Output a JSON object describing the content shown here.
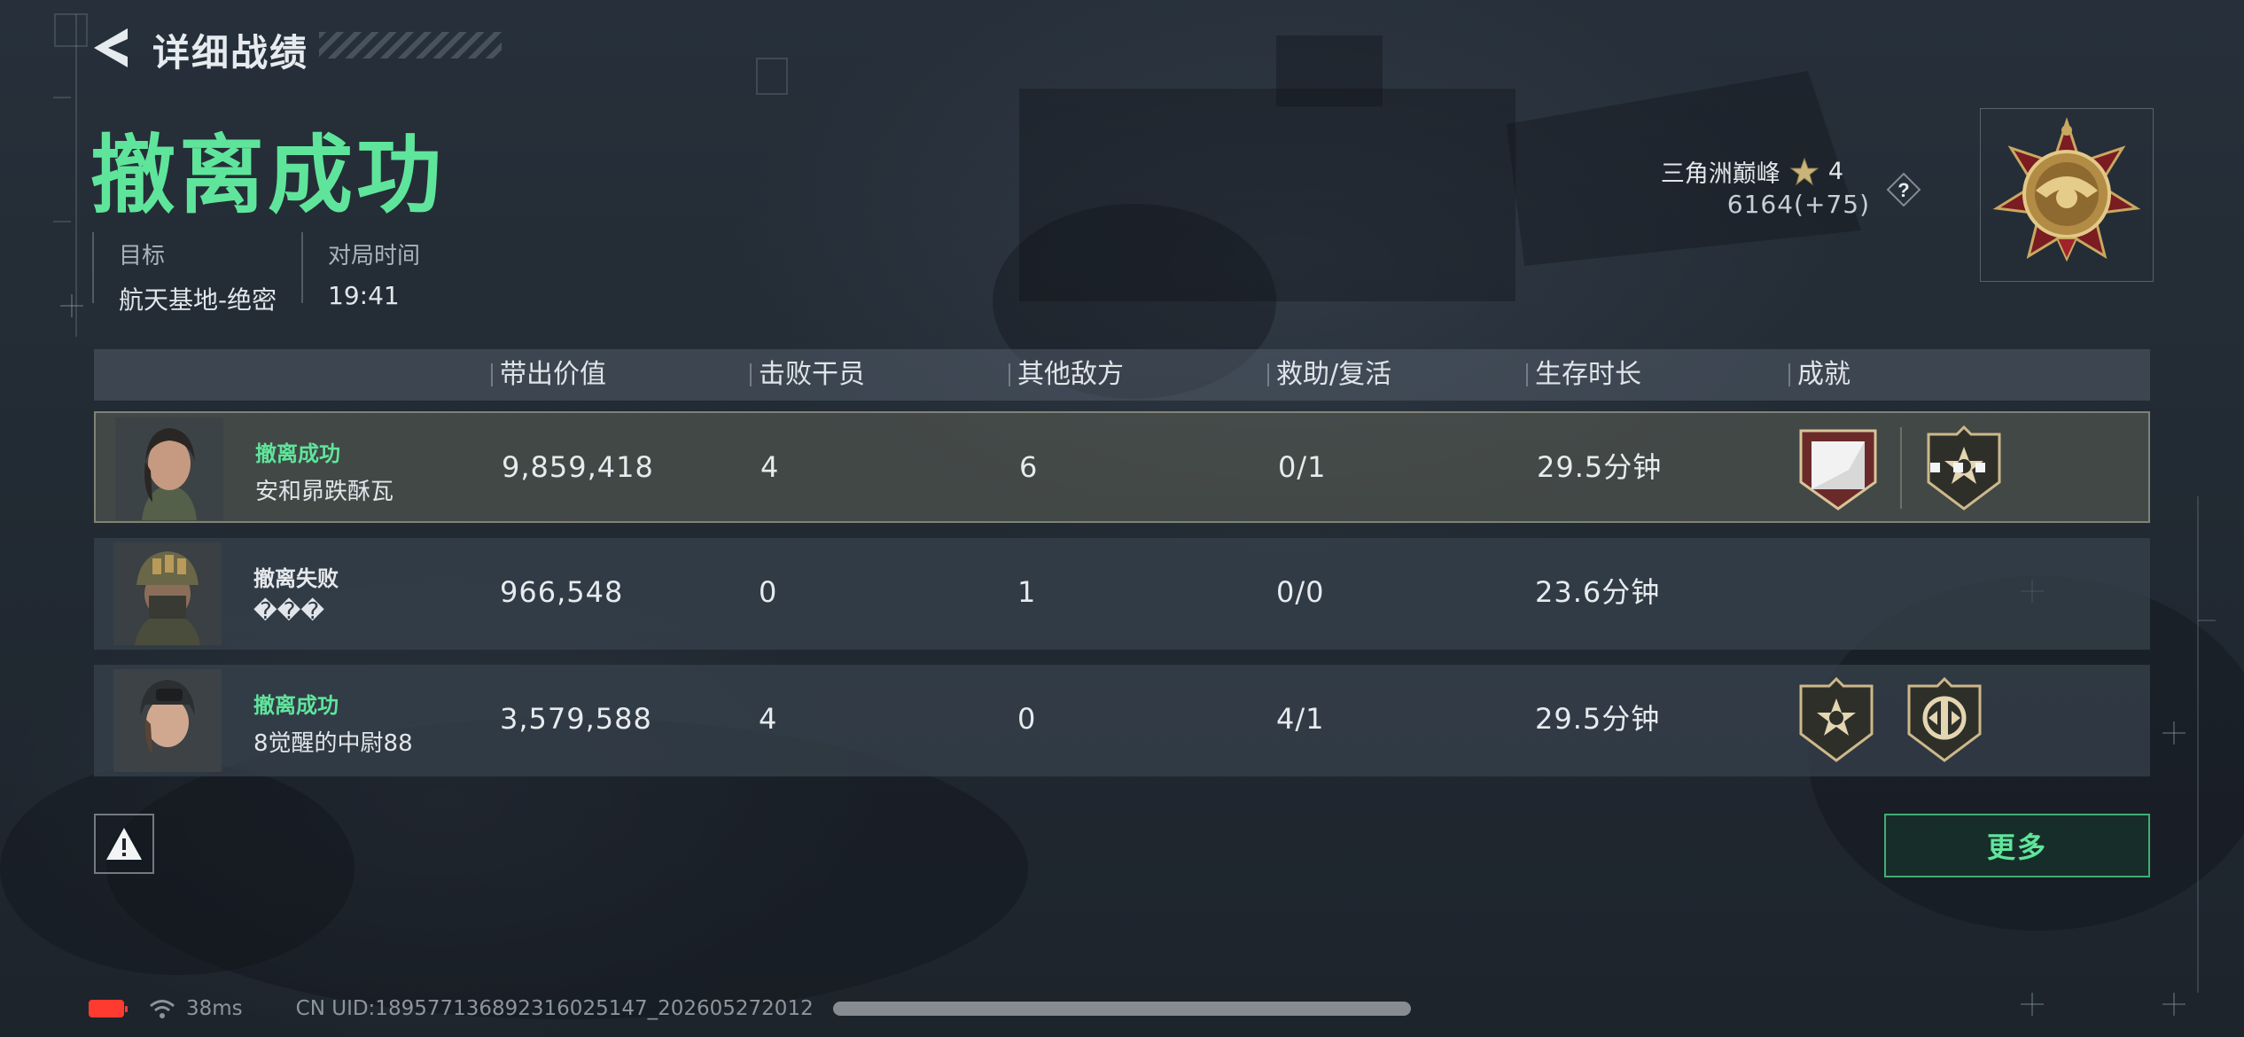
{
  "header": {
    "back_title": "详细战绩",
    "result_title": "撤离成功"
  },
  "meta": {
    "target_label": "目标",
    "target_value": "航天基地-绝密",
    "time_label": "对局时间",
    "time_value": "19:41"
  },
  "rank": {
    "name": "三角洲巅峰",
    "stars": "4",
    "score": "6164(+75)",
    "help_label": "?"
  },
  "table": {
    "columns": [
      "带出价值",
      "击败干员",
      "其他敌方",
      "救助/复活",
      "生存时长",
      "成就"
    ],
    "rows": [
      {
        "status": "撤离成功",
        "name": "安和昴跌酥瓦",
        "value": "9,859,418",
        "kills": "4",
        "other": "6",
        "assist": "0/1",
        "survival": "29.5分钟"
      },
      {
        "status": "撤离失败",
        "name": "���",
        "value": "966,548",
        "kills": "0",
        "other": "1",
        "assist": "0/0",
        "survival": "23.6分钟"
      },
      {
        "status": "撤离成功",
        "name": "8觉醒的中尉88",
        "value": "3,579,588",
        "kills": "4",
        "other": "0",
        "assist": "4/1",
        "survival": "29.5分钟"
      }
    ]
  },
  "buttons": {
    "more": "更多"
  },
  "footer": {
    "ping": "38ms",
    "uid": "CN UID:189577136892316025147_202605272012"
  },
  "colors": {
    "accent_green": "#5fe59b",
    "battery_low": "#ff3b30"
  },
  "icons": [
    "back-arrow-icon",
    "star-icon",
    "help-icon",
    "rank-emblem-icon",
    "achievement-badge-icon",
    "warning-icon",
    "battery-icon",
    "wifi-icon"
  ]
}
